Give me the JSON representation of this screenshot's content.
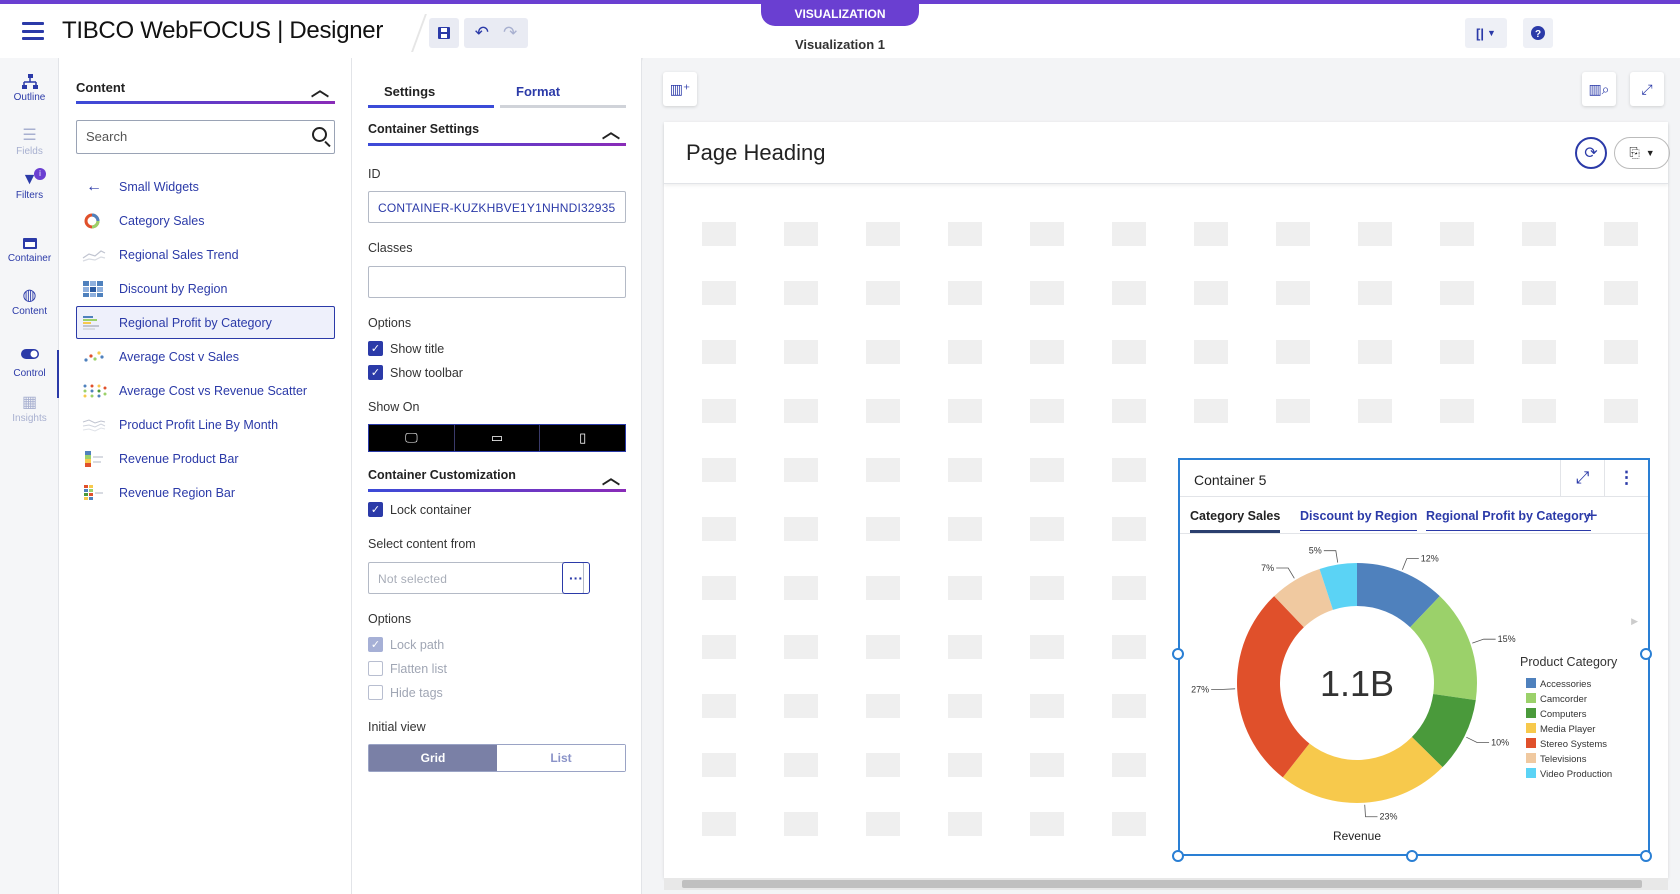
{
  "app": {
    "brand": "TIBCO WebFOCUS | Designer",
    "mode_tab": "VISUALIZATION",
    "doc_title": "Visualization 1"
  },
  "leftnav": [
    {
      "label": "Outline",
      "icon": "outline-icon"
    },
    {
      "label": "Fields",
      "icon": "list-icon"
    },
    {
      "label": "Filters",
      "icon": "filter-icon"
    },
    {
      "label": "Container",
      "icon": "container-icon"
    },
    {
      "label": "Content",
      "icon": "globe-icon"
    },
    {
      "label": "Control",
      "icon": "toggle-icon"
    },
    {
      "label": "Insights",
      "icon": "insights-icon"
    }
  ],
  "content_panel": {
    "title": "Content",
    "search_placeholder": "Search",
    "back_label": "Small Widgets",
    "items": [
      "Category Sales",
      "Regional Sales Trend",
      "Discount by Region",
      "Regional Profit by Category",
      "Average Cost v Sales",
      "Average Cost vs Revenue Scatter",
      "Product Profit Line By Month",
      "Revenue Product Bar",
      "Revenue Region Bar"
    ],
    "selected_index": 3
  },
  "settings_panel": {
    "tabs": [
      "Settings",
      "Format"
    ],
    "container_settings_title": "Container Settings",
    "id_label": "ID",
    "id_value": "CONTAINER-KUZKHBVE1Y1NHNDI32935",
    "classes_label": "Classes",
    "options_label": "Options",
    "show_title": "Show title",
    "show_toolbar": "Show toolbar",
    "show_on_label": "Show On",
    "customization_title": "Container Customization",
    "lock_container": "Lock container",
    "select_content_label": "Select content from",
    "select_content_placeholder": "Not selected",
    "options2_label": "Options",
    "lock_path": "Lock path",
    "flatten_list": "Flatten list",
    "hide_tags": "Hide tags",
    "initial_view_label": "Initial view",
    "view_grid": "Grid",
    "view_list": "List"
  },
  "canvas": {
    "page_heading": "Page Heading",
    "container": {
      "title": "Container 5",
      "tabs": [
        "Category Sales",
        "Discount by Region",
        "Regional Profit by Category"
      ],
      "add_tab": "+"
    }
  },
  "chart_data": {
    "type": "pie",
    "variant": "donut",
    "center_label": "1.1B",
    "xlabel": "Revenue",
    "legend_title": "Product Category",
    "legend_position": "right",
    "categories": [
      "Accessories",
      "Camcorder",
      "Computers",
      "Media Player",
      "Stereo Systems",
      "Televisions",
      "Video Production"
    ],
    "values": [
      12,
      15,
      10,
      23,
      27,
      7,
      5
    ],
    "value_labels": [
      "12%",
      "15%",
      "10%",
      "23%",
      "27%",
      "7%",
      "5%"
    ],
    "colors": [
      "#4f81bd",
      "#9bd16a",
      "#4a9a3b",
      "#f7c94c",
      "#e0502b",
      "#f0c9a0",
      "#5bd3f5"
    ]
  }
}
